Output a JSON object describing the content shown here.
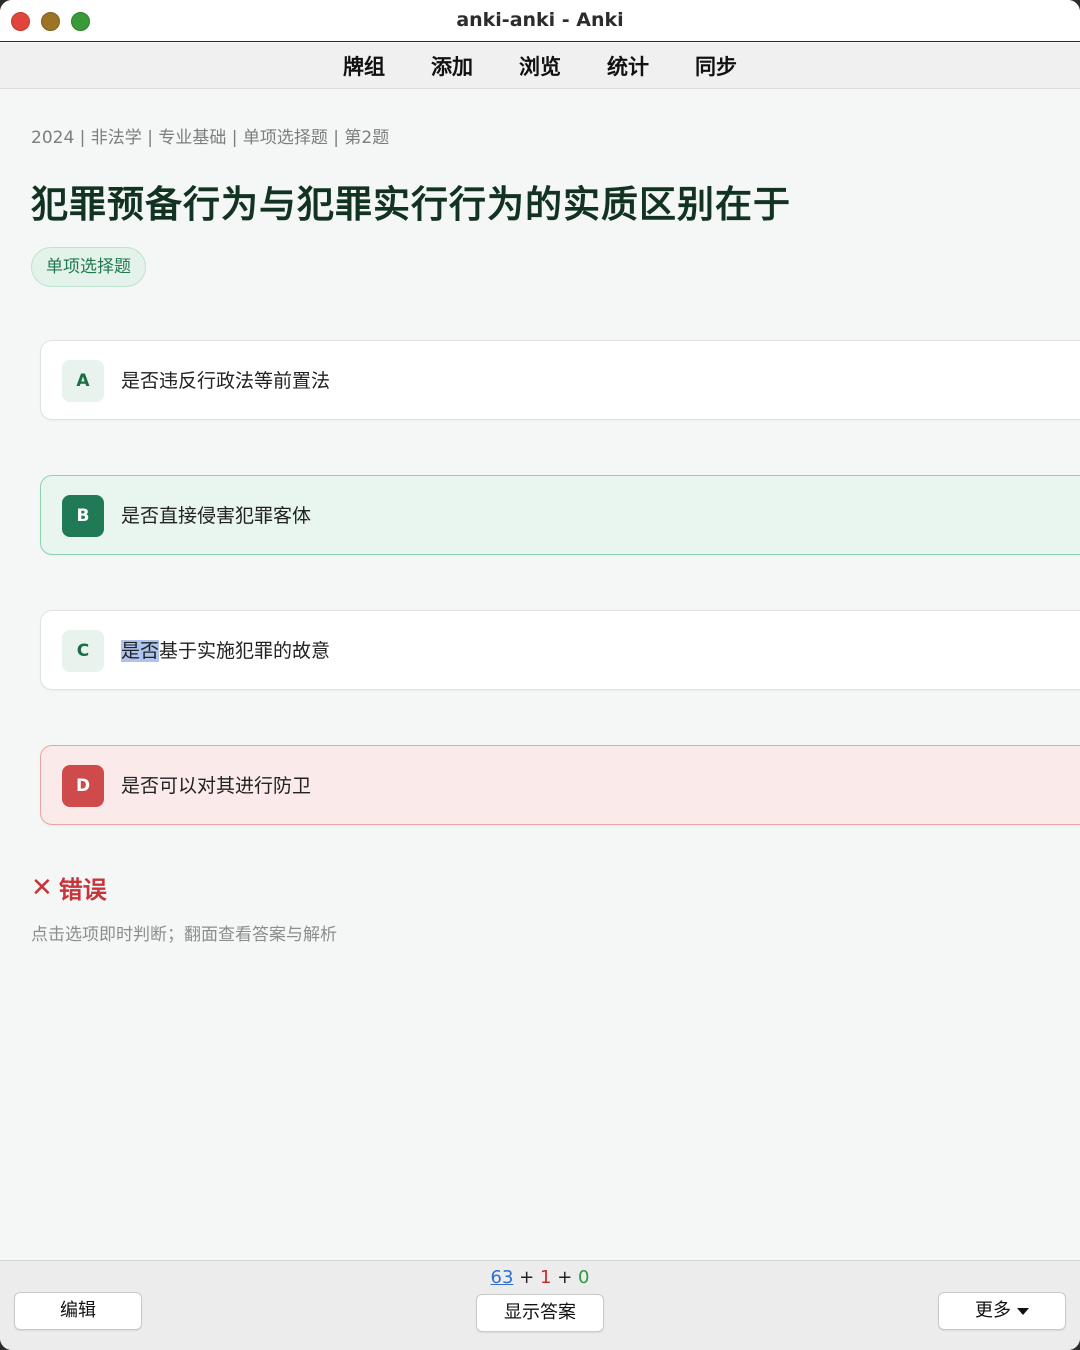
{
  "window": {
    "title": "anki-anki - Anki"
  },
  "menu": {
    "items": [
      "牌组",
      "添加",
      "浏览",
      "统计",
      "同步"
    ]
  },
  "card": {
    "breadcrumb": "2024 | 非法学 | 专业基础 | 单项选择题 | 第2题",
    "question": "犯罪预备行为与犯罪实行行为的实质区别在于",
    "type_badge": "单项选择题",
    "options": [
      {
        "letter": "A",
        "text": "是否违反行政法等前置法",
        "state": "normal"
      },
      {
        "letter": "B",
        "text": "是否直接侵害犯罪客体",
        "state": "correct"
      },
      {
        "letter": "C",
        "text_selected": "是否",
        "text_rest": "基于实施犯罪的故意",
        "state": "normal"
      },
      {
        "letter": "D",
        "text": "是否可以对其进行防卫",
        "state": "wrong"
      }
    ],
    "result_icon": "✕",
    "result_text": "错误",
    "hint": "点击选项即时判断；翻面查看答案与解析"
  },
  "bottom": {
    "edit_label": "编辑",
    "show_answer_label": "显示答案",
    "more_label": "更多",
    "counts": {
      "new": "63",
      "plus1": "+",
      "learn": "1",
      "plus2": "+",
      "review": "0"
    }
  },
  "colors": {
    "correct": "#1f7a55",
    "wrong": "#cf4a4a",
    "title_text": "#123322"
  }
}
